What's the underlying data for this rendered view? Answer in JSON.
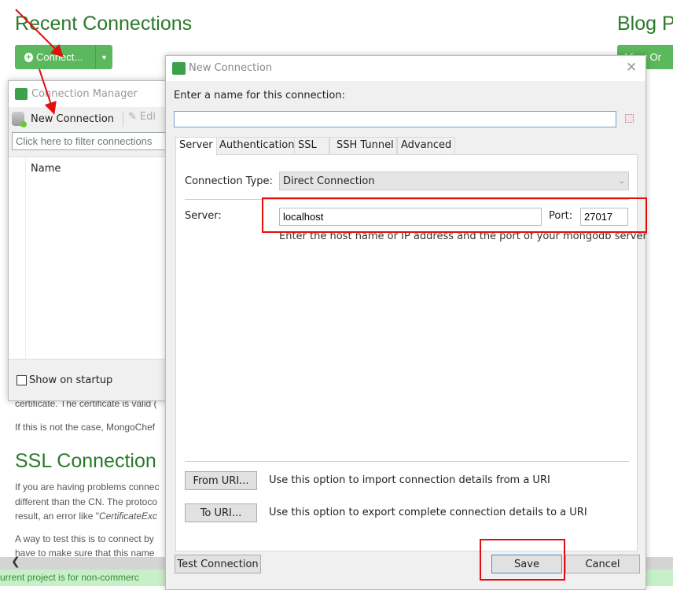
{
  "page": {
    "recent_title": "Recent Connections",
    "connect_label": "Connect...",
    "blog_title": "Blog P",
    "view_label": "View Or",
    "para1": "certificate. The certificate is valid (",
    "para2": "If this is not the case, MongoChef",
    "ssl_title": "SSL Connection",
    "para3_l1": "If you are having problems connec",
    "para3_l2": "different than the CN. The protoco",
    "para3_l3_a": "result, an error like \"",
    "para3_l3_b": "CertificateExc",
    "para4_l1": "A way to test this is to connect by",
    "para4_l2": "have to make sure that this name",
    "footer": "urrent project is for non-commerc"
  },
  "manager": {
    "title": "Connection Manager",
    "new_connection": "New Connection",
    "edit": "Edi",
    "filter_placeholder": "Click here to filter connections",
    "col_name": "Name",
    "show_on_startup": "Show on startup"
  },
  "dialog": {
    "title": "New Connection",
    "name_prompt": "Enter a name for this connection:",
    "name_value": "",
    "tabs": [
      {
        "label": "Server"
      },
      {
        "label": "Authentication"
      },
      {
        "label": "SSL"
      },
      {
        "label": "SSH Tunnel"
      },
      {
        "label": "Advanced"
      }
    ],
    "active_tab": "Server",
    "connection_type_label": "Connection Type:",
    "connection_type_value": "Direct Connection",
    "server_label": "Server:",
    "server_value": "localhost",
    "port_label": "Port:",
    "port_value": "27017",
    "server_hint": "Enter the host name or IP address and the port of your mongodb server",
    "from_uri": "From URI...",
    "from_uri_desc": "Use this option to import connection details from a URI",
    "to_uri": "To URI...",
    "to_uri_desc": "Use this option to export complete connection details to a URI",
    "test_connection": "Test Connection",
    "save": "Save",
    "cancel": "Cancel"
  },
  "colors": {
    "brand_green": "#5cb85c",
    "heading_green": "#2a7a2a",
    "annotation_red": "#e01010",
    "accent_blue": "#3c8fd8"
  }
}
